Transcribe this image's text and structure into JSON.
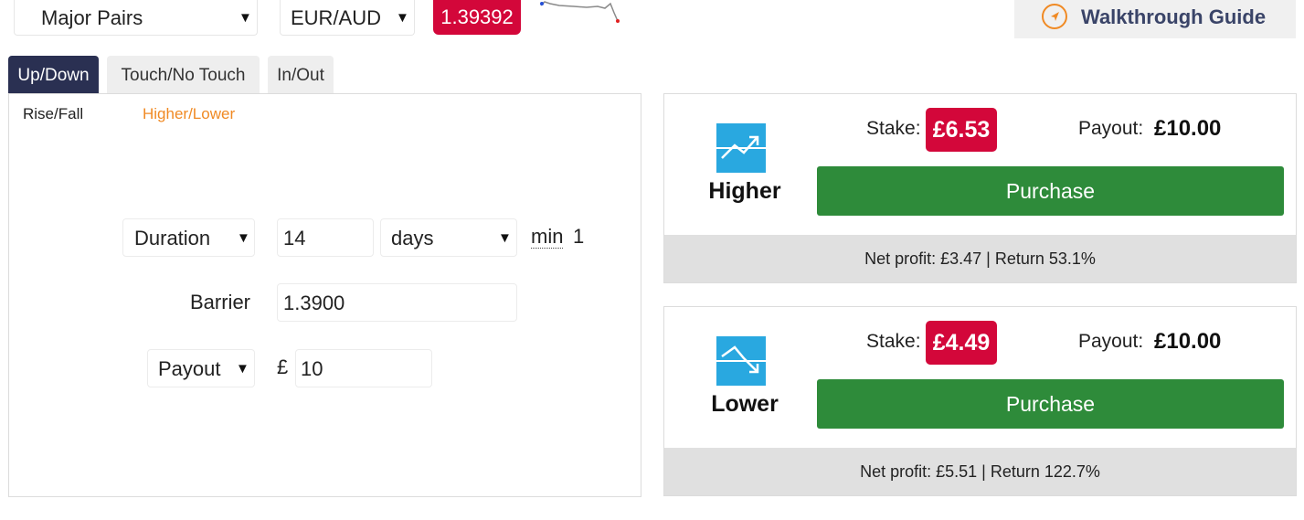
{
  "top": {
    "market_select": "Major Pairs",
    "symbol_select": "EUR/AUD",
    "spot_price": "1.39392",
    "guide_label": "Walkthrough Guide"
  },
  "tabs": [
    {
      "label": "Up/Down",
      "active": true
    },
    {
      "label": "Touch/No Touch",
      "active": false
    },
    {
      "label": "In/Out",
      "active": false
    }
  ],
  "subtabs": [
    {
      "label": "Rise/Fall",
      "active": false
    },
    {
      "label": "Higher/Lower",
      "active": true
    }
  ],
  "form": {
    "duration_select": "Duration",
    "duration_value": "14",
    "duration_unit": "days",
    "min_label": "min",
    "min_value": "1",
    "barrier_label": "Barrier",
    "barrier_value": "1.3900",
    "payout_select": "Payout",
    "currency_symbol": "£",
    "payout_amount": "10"
  },
  "contracts": [
    {
      "name": "Higher",
      "icon": "higher-icon",
      "stake_label": "Stake:",
      "stake": "£6.53",
      "payout_label": "Payout:",
      "payout": "£10.00",
      "button": "Purchase",
      "summary": "Net profit: £3.47 | Return 53.1%"
    },
    {
      "name": "Lower",
      "icon": "lower-icon",
      "stake_label": "Stake:",
      "stake": "£4.49",
      "payout_label": "Payout:",
      "payout": "£10.00",
      "button": "Purchase",
      "summary": "Net profit: £5.51 | Return 122.7%"
    }
  ],
  "colors": {
    "accent_red": "#d3073a",
    "purchase_green": "#2e8b3a",
    "active_tab": "#2a3052",
    "active_subtab": "#f08a24",
    "icon_blue": "#29a8e0"
  }
}
